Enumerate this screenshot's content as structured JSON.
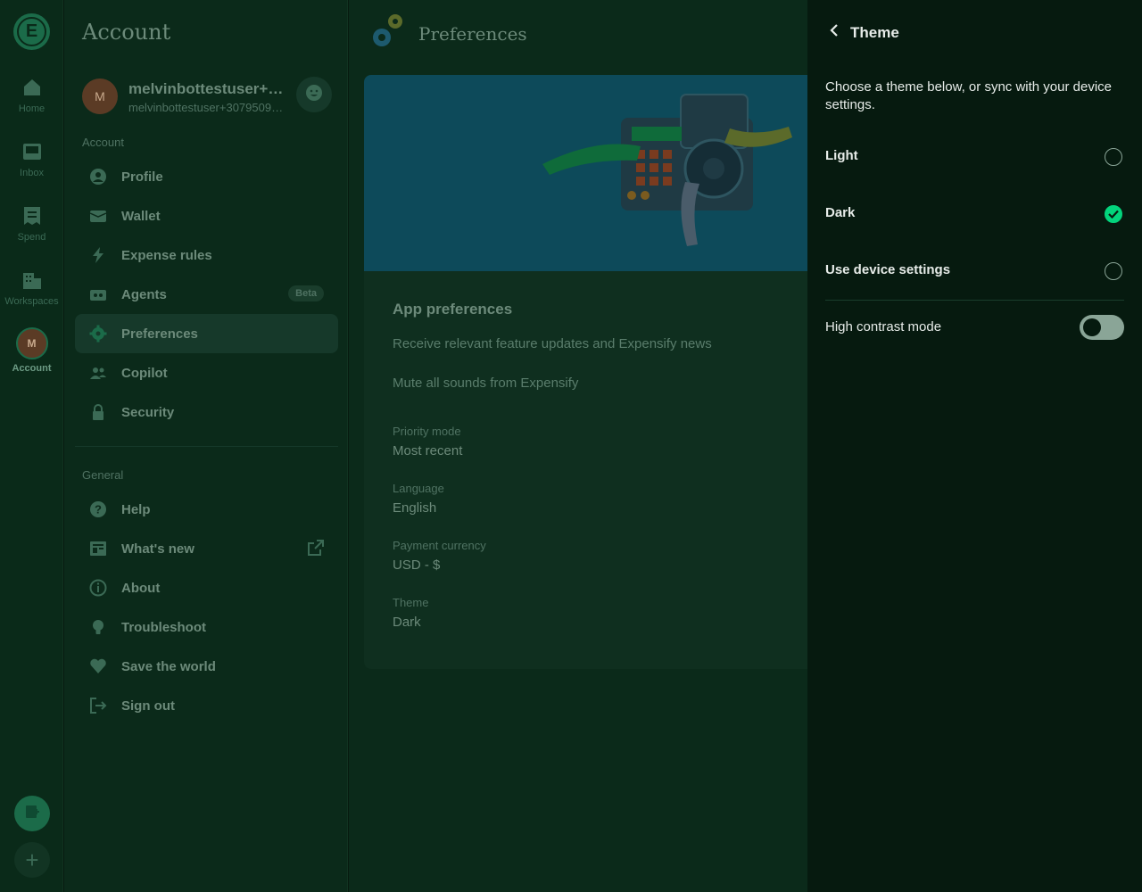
{
  "rail": {
    "items": [
      {
        "label": "Home",
        "icon": "home-icon"
      },
      {
        "label": "Inbox",
        "icon": "inbox-icon"
      },
      {
        "label": "Spend",
        "icon": "receipt-icon"
      },
      {
        "label": "Workspaces",
        "icon": "building-icon"
      },
      {
        "label": "Account",
        "icon": "avatar"
      }
    ],
    "avatar_initial": "M",
    "logo_letter": "E"
  },
  "sidebar": {
    "title": "Account",
    "user": {
      "initial": "M",
      "name": "melvinbottestuser+3…",
      "email": "melvinbottestuser+30795091…"
    },
    "account_label": "Account",
    "account_items": [
      {
        "label": "Profile"
      },
      {
        "label": "Wallet"
      },
      {
        "label": "Expense rules"
      },
      {
        "label": "Agents",
        "badge": "Beta"
      },
      {
        "label": "Preferences"
      },
      {
        "label": "Copilot"
      },
      {
        "label": "Security"
      }
    ],
    "general_label": "General",
    "general_items": [
      {
        "label": "Help"
      },
      {
        "label": "What's new"
      },
      {
        "label": "About"
      },
      {
        "label": "Troubleshoot"
      },
      {
        "label": "Save the world"
      },
      {
        "label": "Sign out"
      }
    ]
  },
  "main": {
    "title": "Preferences",
    "section_title": "App preferences",
    "rows": [
      "Receive relevant feature updates and Expensify news",
      "Mute all sounds from Expensify"
    ],
    "fields": [
      {
        "label": "Priority mode",
        "value": "Most recent"
      },
      {
        "label": "Language",
        "value": "English"
      },
      {
        "label": "Payment currency",
        "value": "USD - $"
      },
      {
        "label": "Theme",
        "value": "Dark"
      }
    ]
  },
  "panel": {
    "title": "Theme",
    "description": "Choose a theme below, or sync with your device settings.",
    "options": [
      {
        "label": "Light",
        "selected": false
      },
      {
        "label": "Dark",
        "selected": true
      },
      {
        "label": "Use device settings",
        "selected": false
      }
    ],
    "high_contrast_label": "High contrast mode",
    "high_contrast_on": false
  },
  "colors": {
    "accent": "#03d47c",
    "panel_bg": "#061a0f",
    "dim_bg": "#0b2a1a",
    "brand": "#1b6b49"
  }
}
